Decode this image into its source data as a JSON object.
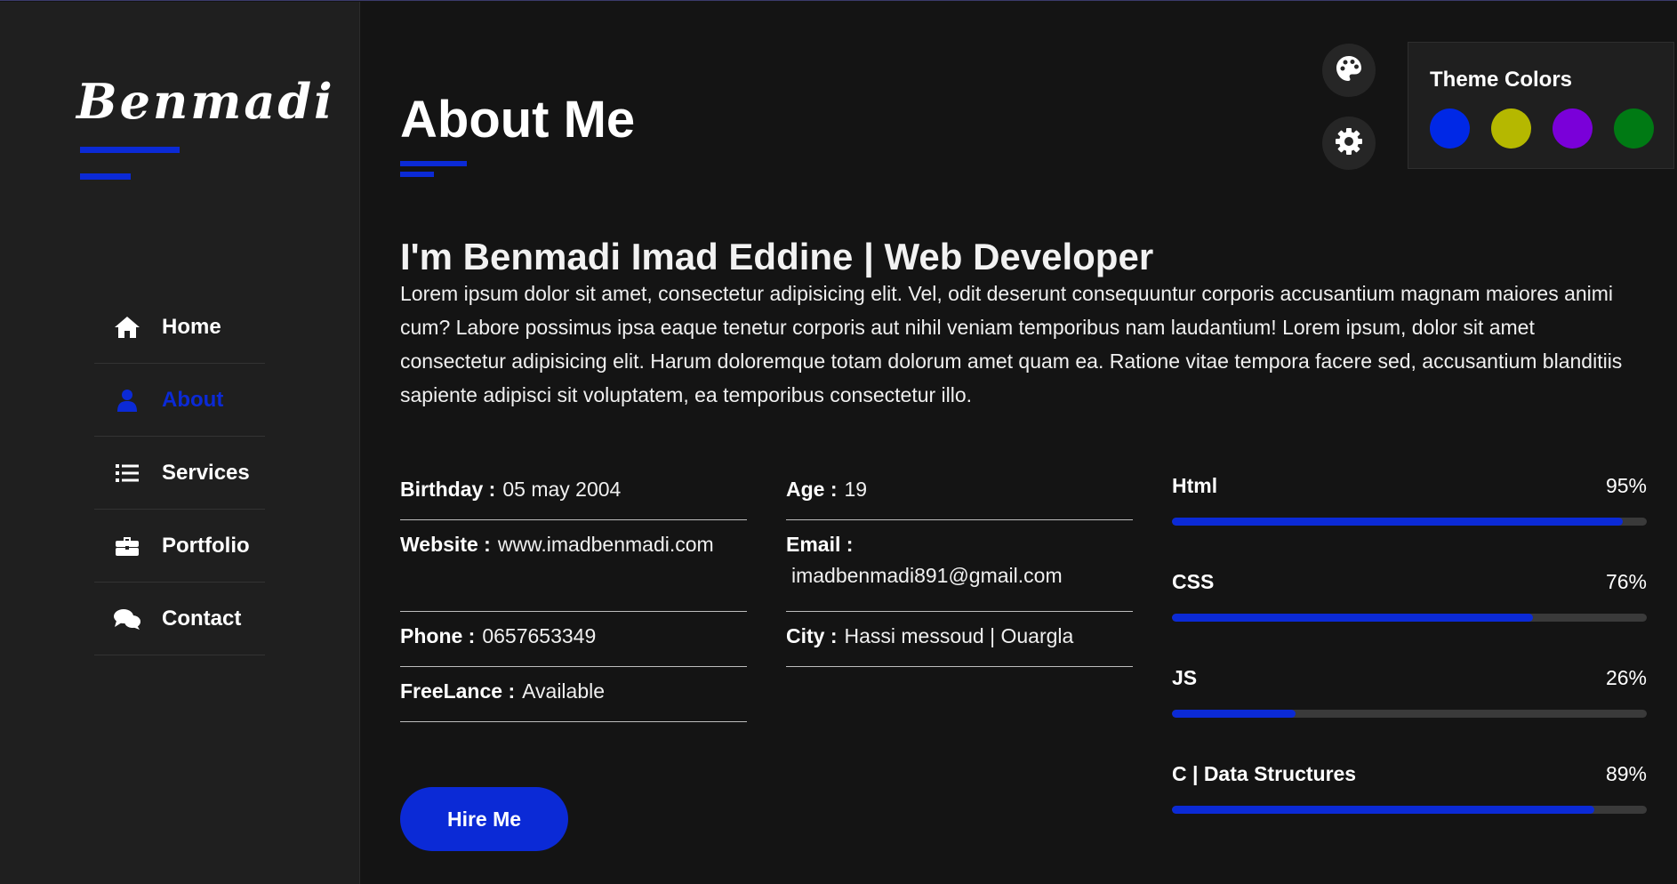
{
  "sidebar": {
    "logo": "Benmadi",
    "nav": [
      {
        "label": "Home",
        "icon": "home-icon",
        "active": false
      },
      {
        "label": "About",
        "icon": "user-icon",
        "active": true
      },
      {
        "label": "Services",
        "icon": "list-icon",
        "active": false
      },
      {
        "label": "Portfolio",
        "icon": "briefcase-icon",
        "active": false
      },
      {
        "label": "Contact",
        "icon": "comments-icon",
        "active": false
      }
    ]
  },
  "main": {
    "title": "About Me",
    "headline": "I'm Benmadi Imad Eddine | Web Developer",
    "intro": "Lorem ipsum dolor sit amet, consectetur adipisicing elit. Vel, odit deserunt consequuntur corporis accusantium magnam maiores animi cum? Labore possimus ipsa eaque tenetur corporis aut nihil veniam temporibus nam laudantium! Lorem ipsum, dolor sit amet consectetur adipisicing elit. Harum doloremque totam dolorum amet quam ea. Ratione vitae tempora facere sed, accusantium blanditiis sapiente adipisci sit voluptatem, ea temporibus consectetur illo.",
    "info_left": [
      {
        "key": "Birthday :",
        "value": "05 may 2004"
      },
      {
        "key": "Website :",
        "value": "www.imadbenmadi.com"
      },
      {
        "key": "Phone :",
        "value": "0657653349"
      },
      {
        "key": "FreeLance :",
        "value": "Available"
      }
    ],
    "info_right": [
      {
        "key": "Age :",
        "value": "19"
      },
      {
        "key": "Email :",
        "value": "imadbenmadi891@gmail.com"
      },
      {
        "key": "City :",
        "value": "Hassi messoud | Ouargla"
      }
    ],
    "skills": [
      {
        "name": "Html",
        "percent_label": "95%",
        "level": 95
      },
      {
        "name": "CSS",
        "percent_label": "76%",
        "level": 76
      },
      {
        "name": "JS",
        "percent_label": "26%",
        "level": 26
      },
      {
        "name": "C | Data Structures",
        "percent_label": "89%",
        "level": 89
      }
    ],
    "hire_button": "Hire Me"
  },
  "theme": {
    "title": "Theme Colors",
    "accent": "#0b2ad6",
    "swatches": [
      "#0028e6",
      "#b5b800",
      "#7a00d9",
      "#007a14"
    ],
    "palette_icon": "palette-icon",
    "settings_icon": "gear-icon"
  }
}
